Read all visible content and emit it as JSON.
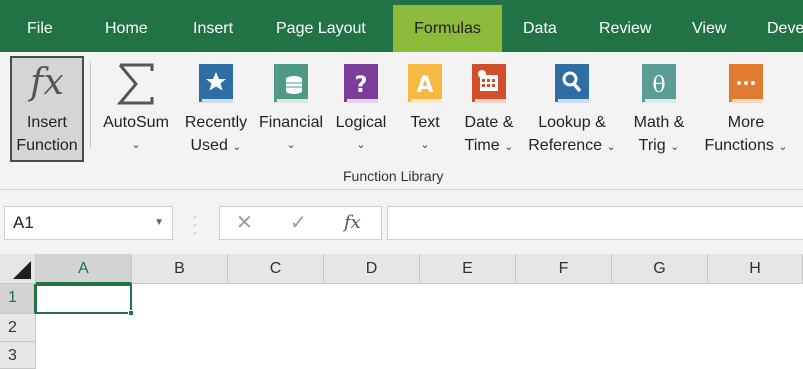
{
  "tabs": [
    {
      "label": "File"
    },
    {
      "label": "Home"
    },
    {
      "label": "Insert"
    },
    {
      "label": "Page Layout"
    },
    {
      "label": "Formulas",
      "active": true
    },
    {
      "label": "Data"
    },
    {
      "label": "Review"
    },
    {
      "label": "View"
    },
    {
      "label": "Deve"
    }
  ],
  "ribbon": {
    "insert_function": {
      "glyph": "fx",
      "line1": "Insert",
      "line2": "Function",
      "icon": "fx-icon"
    },
    "buttons": [
      {
        "line1": "AutoSum",
        "line2": "",
        "icon": "sigma-icon"
      },
      {
        "line1": "Recently",
        "line2": "Used",
        "icon": "star-book-icon"
      },
      {
        "line1": "Financial",
        "line2": "",
        "icon": "coins-book-icon"
      },
      {
        "line1": "Logical",
        "line2": "",
        "icon": "question-book-icon"
      },
      {
        "line1": "Text",
        "line2": "",
        "icon": "letter-a-book-icon"
      },
      {
        "line1": "Date &",
        "line2": "Time",
        "icon": "calendar-book-icon"
      },
      {
        "line1": "Lookup &",
        "line2": "Reference",
        "icon": "magnifier-book-icon"
      },
      {
        "line1": "Math &",
        "line2": "Trig",
        "icon": "theta-book-icon"
      },
      {
        "line1": "More",
        "line2": "Functions",
        "icon": "ellipsis-book-icon"
      }
    ],
    "group_label": "Function Library",
    "colors": {
      "tab_bar": "#217346",
      "active_tab": "#8cbb3c",
      "blue_book": "#2f6ea5",
      "green_book": "#4f9a84",
      "purple_book": "#7a3d9a",
      "yellow_book": "#f5b843",
      "red_book": "#d34f2c",
      "teal_book": "#5a9d94",
      "orange_book": "#e07b2f"
    }
  },
  "formula_bar": {
    "name_box": "A1",
    "cancel_glyph": "✕",
    "enter_glyph": "✓",
    "fx_glyph": "fx",
    "value": ""
  },
  "sheet": {
    "columns": [
      "A",
      "B",
      "C",
      "D",
      "E",
      "F",
      "G",
      "H"
    ],
    "rows": [
      "1",
      "2",
      "3"
    ],
    "selected_cell": "A1"
  }
}
